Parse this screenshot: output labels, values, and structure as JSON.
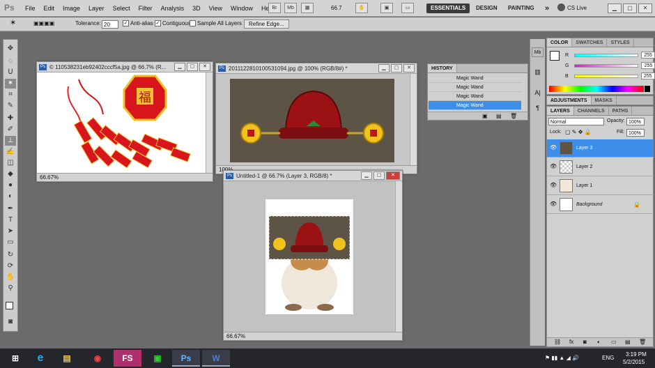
{
  "app": {
    "logo": "Ps"
  },
  "menu": [
    "File",
    "Edit",
    "Image",
    "Layer",
    "Select",
    "Filter",
    "Analysis",
    "3D",
    "View",
    "Window",
    "Help"
  ],
  "appbar": {
    "zoom": "66.7",
    "workspaces": [
      "ESSENTIALS",
      "DESIGN",
      "PAINTING"
    ],
    "more": "»",
    "cslive": "CS Live"
  },
  "options": {
    "tolerance_label": "Tolerance:",
    "tolerance_value": "20",
    "antialias": "Anti-alias",
    "contiguous": "Contiguous",
    "sample_all": "Sample All Layers",
    "refine": "Refine Edge..."
  },
  "docs": {
    "d1": {
      "title": "© 110538231eb92402cccf5a.jpg @ 66.7% (R...",
      "zoom": "66.67%"
    },
    "d2": {
      "title": "2011122810100531094.jpg @ 100% (RGB/8#) *",
      "zoom": "100%"
    },
    "d3": {
      "title": "Untitled-1 @ 66.7% (Layer 3, RGB/8) *",
      "zoom": "66.67%"
    }
  },
  "history": {
    "tab": "HISTORY",
    "items": [
      "Magic Wand",
      "Magic Wand",
      "Magic Wand",
      "Magic Wand"
    ]
  },
  "color": {
    "tabs": [
      "COLOR",
      "SWATCHES",
      "STYLES"
    ],
    "r_label": "R",
    "g_label": "G",
    "b_label": "B",
    "r": "255",
    "g": "255",
    "b": "255"
  },
  "adjust": {
    "tabs": [
      "ADJUSTMENTS",
      "MASKS"
    ]
  },
  "layers": {
    "tabs": [
      "LAYERS",
      "CHANNELS",
      "PATHS"
    ],
    "blend": "Normal",
    "opacity_label": "Opacity:",
    "opacity": "100%",
    "lock_label": "Lock:",
    "fill_label": "Fill:",
    "fill": "100%",
    "items": [
      "Layer 3",
      "Layer 2",
      "Layer 1",
      "Background"
    ]
  },
  "taskbar": {
    "lang": "ENG",
    "time": "3:19 PM",
    "date": "5/2/2015",
    "fs": "FS",
    "ps": "Ps",
    "word": "W"
  }
}
